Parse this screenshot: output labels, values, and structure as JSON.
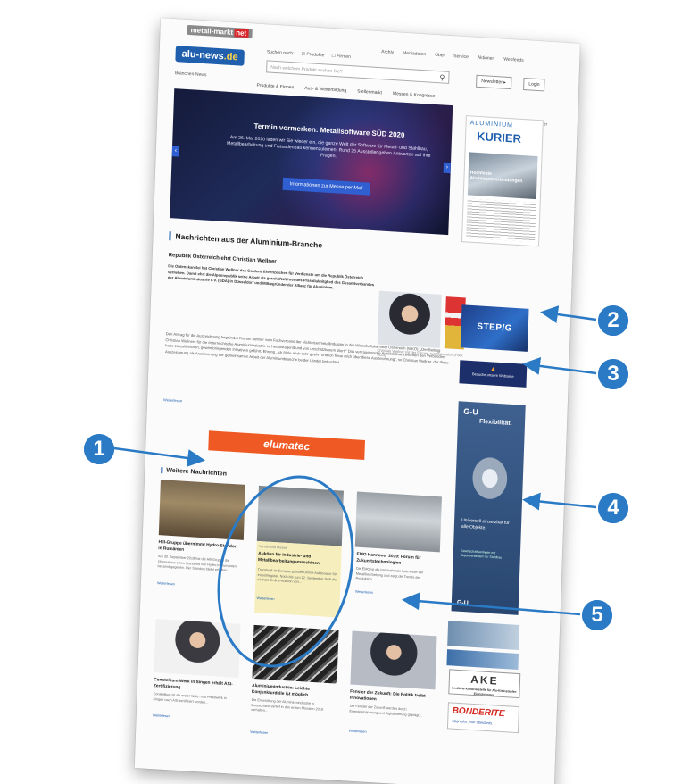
{
  "site": {
    "network_logo": "metall-markt",
    "network_logo_suffix": "net",
    "logo": "alu-news",
    "logo_suffix": ".de",
    "branchen_link": "Branchen-News"
  },
  "top_nav": [
    "Archiv",
    "Mediadaten",
    "Über",
    "Service",
    "Aktionen",
    "Webfeeds"
  ],
  "search": {
    "caption": "Suchen nach:",
    "option1": "Produkte",
    "option2": "Firmen",
    "placeholder": "Nach welchem Produkt suchen Sie?"
  },
  "buttons": {
    "newsletter": "Newsletter",
    "login": "Login"
  },
  "sub_nav": [
    "Produkte & Firmen",
    "Aus- & Weiterbildung",
    "Stellenmarkt",
    "Messen & Kongresse"
  ],
  "partner_label": "Partner",
  "banner": {
    "title": "Termin vormerken: Metallsoftware SÜD 2020",
    "text": "Am 26. Mai 2020 laden wir Sie wieder ein, die ganze Welt der Software für Metall- und Stahlbau, Metallbearbeitung und Fassadenbau kennenzulernen. Rund 25 Aussteller geben Antworten auf Ihre Fragen.",
    "button": "Informationen zur Messe per Mail"
  },
  "kurier": {
    "top": "ALUMINIUM",
    "name": "KURIER",
    "cover_headline": "Hochfeste Aluminiumverbindungen"
  },
  "section_heading": "Nachrichten aus der Aluminium-Branche",
  "article": {
    "title": "Republik Österreich ehrt Christian Wellner",
    "lead": "Die Ordenskanzlei hat Christian Wellner das Goldene Ehrenzeichen für Verdienste um die Republik Österreich verliehen. Damit ehrt die Alpenrepublik seine Arbeit als geschäftsführendes Präsidialmitglied des Gesamtverbandes der Aluminiumindustrie e.V. (GDA) in Düsseldorf und Mitbegründer der Allianz für Aluminium.",
    "body": "Den Antrag für die Auszeichnung begründet Roman Stiftner vom Fachverband der Nichteisenmetallindustrie in der Wirtschaftskammer Österreich (WKO): „Der Beitrag Christian Wellners für die österreichische Aluminiumindustrie ist herausragend und von unschätzbarem Wert.“ Das vertrauensvolle Arbeitsklima zwischen den Verbänden habe zu zahlreichen, gewinnbringenden Initiativen geführt. Ehrung „Ich fühle mich sehr geehrt und ich freue mich über diese Auszeichnung“, so Christian Wellner, der diese Auszeichnung als Anerkennung der gemeinsamen Arbeit der Aluminiumbranche beider Länder betrachtet.",
    "photo_caption": "Christian Wellner mit der Ehrung aus Österreich (Foto: GDA)",
    "more": "Weiterlesen"
  },
  "ads": {
    "stepg": "STEP/G",
    "small_ad": "Besuche unsere Webseite",
    "elumatec": "elumatec",
    "gu_logo": "G-U",
    "gu_tagline": "Flexibilität.",
    "gu_text": "Universell einsetzbar für alle Objekte.",
    "gu_small": "Gesellschaftsanlagen mit Objektverbindern für Stahlbau",
    "gu_footer": "G-U",
    "ake": "AKE",
    "ake_sub": "Amtliche Kalibrierstelle für Alu-Kleinstapler-Einrichtungen",
    "bonderite": "BONDERITE",
    "bonderite_sub": "Upgrades your standards."
  },
  "more_news": {
    "heading": "Weitere Nachrichten",
    "cards": [
      {
        "title": "Hill-Gruppe übernimmt Hydro-Standort in Rumänien",
        "text": "Am 30. September 2019 hat die Hill-Gruppe die Übernahme eines Standorts von Hydro in Rumänien bekannt gegeben. Der Standort bleibt erhalten...",
        "more": "Weiterlesen"
      },
      {
        "kategorie": "Handel und Messe",
        "title": "Auktion für Industrie- und Metallbearbeitungsmaschinen",
        "text": "Troostwijk ist Europas größter Online-Auktionator für Industriegüter. Noch bis zum 22. September läuft die nächste Online-Auktion von...",
        "more": "Weiterlesen"
      },
      {
        "title": "EMO Hannover 2019: Forum für Zukunftstechnologien",
        "text": "Die EMO ist die internationale Leitmesse der Metallbearbeitung und zeigt die Trends der Produktion...",
        "more": "Weiterlesen"
      },
      {
        "title": "Constellium Werk in Singen erhält ASI-Zertifizierung",
        "text": "Constellium ist als erster Walz- und Presswerk in Singen nach ASI zertifiziert worden...",
        "more": "Weiterlesen"
      },
      {
        "title": "Aluminiumindustrie: Leichte Konjunkturdelle ist möglich",
        "text": "Die Entwicklung der Aluminiumindustrie in Deutschland verlief in den ersten Monaten 2019 verhalten...",
        "more": "Weiterlesen"
      },
      {
        "title": "Fenster der Zukunft: Die Politik treibt Innovationen",
        "text": "Die Fenster der Zukunft werden durch Energieeinsparung und Digitalisierung geprägt...",
        "more": "Weiterlesen"
      }
    ]
  },
  "annotations": [
    "1",
    "2",
    "3",
    "4",
    "5"
  ],
  "colors": {
    "brand": "#1f5fae",
    "annotation": "#2a7ac5",
    "elumatec": "#ef5a24"
  }
}
